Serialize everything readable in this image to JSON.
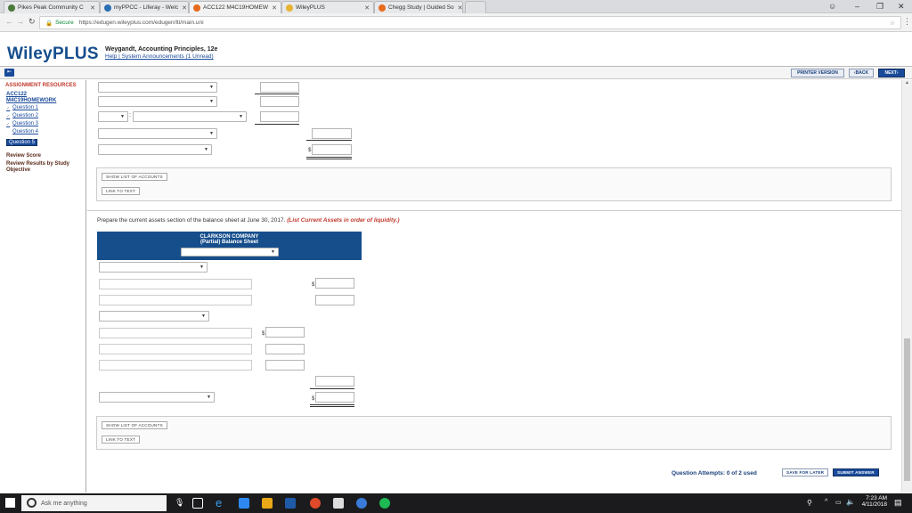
{
  "browser": {
    "tabs": [
      {
        "label": "Pikes Peak Community C",
        "color": "#4a7a3a",
        "active": false
      },
      {
        "label": "myPPCC - Liferay - Welc",
        "color": "#2a6fb4",
        "active": false
      },
      {
        "label": "ACC122 M4C19HOMEW",
        "color": "#e56a1c",
        "active": true
      },
      {
        "label": "WileyPLUS",
        "color": "#e8b430",
        "active": false
      },
      {
        "label": "Chegg Study | Guided So",
        "color": "#e86a1c",
        "active": false
      }
    ],
    "secure_label": "Secure",
    "url": "https://edugen.wileyplus.com/edugen/lti/main.uni"
  },
  "header": {
    "logo": "WileyPLUS",
    "book_title": "Weygandt, Accounting Principles, 12e",
    "links": "Help | System Announcements (1 Unread)",
    "printer_label": "PRINTER VERSION",
    "back_label": "BACK",
    "next_label": "NEXT"
  },
  "sidebar": {
    "heading": "ASSIGNMENT RESOURCES",
    "course": "ACC122",
    "assignment": "M4C19HOMEWORK",
    "questions": [
      {
        "label": "Question 1",
        "checked": true
      },
      {
        "label": "Question 2",
        "checked": true
      },
      {
        "label": "Question 3",
        "checked": true
      },
      {
        "label": "Question 4",
        "checked": false
      }
    ],
    "active_question": "Question 5",
    "review_score": "Review Score",
    "review_results": "Review Results by Study Objective"
  },
  "main": {
    "show_accounts_label": "SHOW LIST OF ACCOUNTS",
    "link_text_label": "LINK TO TEXT",
    "prompt": "Prepare the current assets section of the balance sheet at June 30, 2017.",
    "prompt_note": "(List Current Assets in order of liquidity.)",
    "statement": {
      "company": "CLARKSON COMPANY",
      "subtitle": "(Partial) Balance Sheet"
    },
    "dollar_sign": "$",
    "attempts": "Question Attempts: 0 of 2 used",
    "save_later_label": "SAVE FOR LATER",
    "submit_label": "SUBMIT ANSWER"
  },
  "taskbar": {
    "search_placeholder": "Ask me anything",
    "time": "7:23 AM",
    "date": "4/11/2018"
  }
}
